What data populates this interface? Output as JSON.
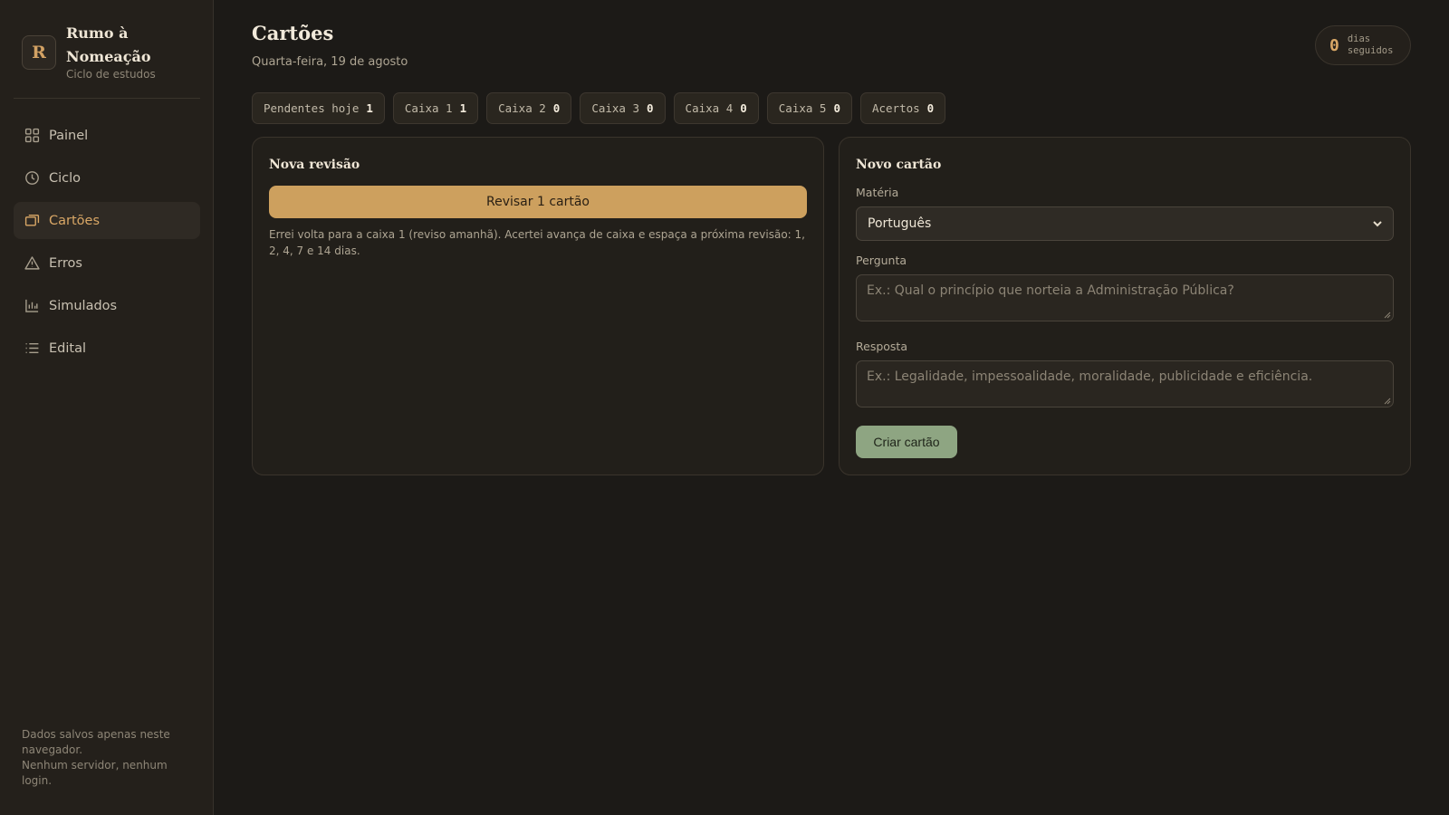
{
  "brand": {
    "logo_letter": "R",
    "name": "Rumo à Nomeação",
    "subtitle": "Ciclo de estudos"
  },
  "nav": {
    "items": [
      {
        "label": "Painel",
        "icon": "grid-icon",
        "active": false
      },
      {
        "label": "Ciclo",
        "icon": "clock-icon",
        "active": false
      },
      {
        "label": "Cartões",
        "icon": "cards-icon",
        "active": true
      },
      {
        "label": "Erros",
        "icon": "warning-icon",
        "active": false
      },
      {
        "label": "Simulados",
        "icon": "bar-chart-icon",
        "active": false
      },
      {
        "label": "Edital",
        "icon": "list-icon",
        "active": false
      }
    ]
  },
  "footer": {
    "line1": "Dados salvos apenas neste navegador.",
    "line2": "Nenhum servidor, nenhum login."
  },
  "header": {
    "title": "Cartões",
    "date": "Quarta-feira, 19 de agosto"
  },
  "streak": {
    "value": "0",
    "label_line1": "dias",
    "label_line2": "seguidos"
  },
  "stats": [
    {
      "label": "Pendentes hoje",
      "value": "1"
    },
    {
      "label": "Caixa 1",
      "value": "1"
    },
    {
      "label": "Caixa 2",
      "value": "0"
    },
    {
      "label": "Caixa 3",
      "value": "0"
    },
    {
      "label": "Caixa 4",
      "value": "0"
    },
    {
      "label": "Caixa 5",
      "value": "0"
    },
    {
      "label": "Acertos",
      "value": "0"
    }
  ],
  "review": {
    "title": "Nova revisão",
    "button": "Revisar 1 cartão",
    "note": "Errei volta para a caixa 1 (reviso amanhã). Acertei avança de caixa e espaça a próxima revisão: 1, 2, 4, 7 e 14 dias."
  },
  "new_card": {
    "title": "Novo cartão",
    "subject_label": "Matéria",
    "subject_value": "Português",
    "question_label": "Pergunta",
    "question_placeholder": "Ex.: Qual o princípio que norteia a Administração Pública?",
    "answer_label": "Resposta",
    "answer_placeholder": "Ex.: Legalidade, impessoalidade, moralidade, publicidade e eficiência.",
    "button": "Criar cartão"
  },
  "colors": {
    "accent": "#d9a766",
    "review_button": "#cda05e",
    "create_button": "#8ea582",
    "background": "#1c1a17"
  }
}
